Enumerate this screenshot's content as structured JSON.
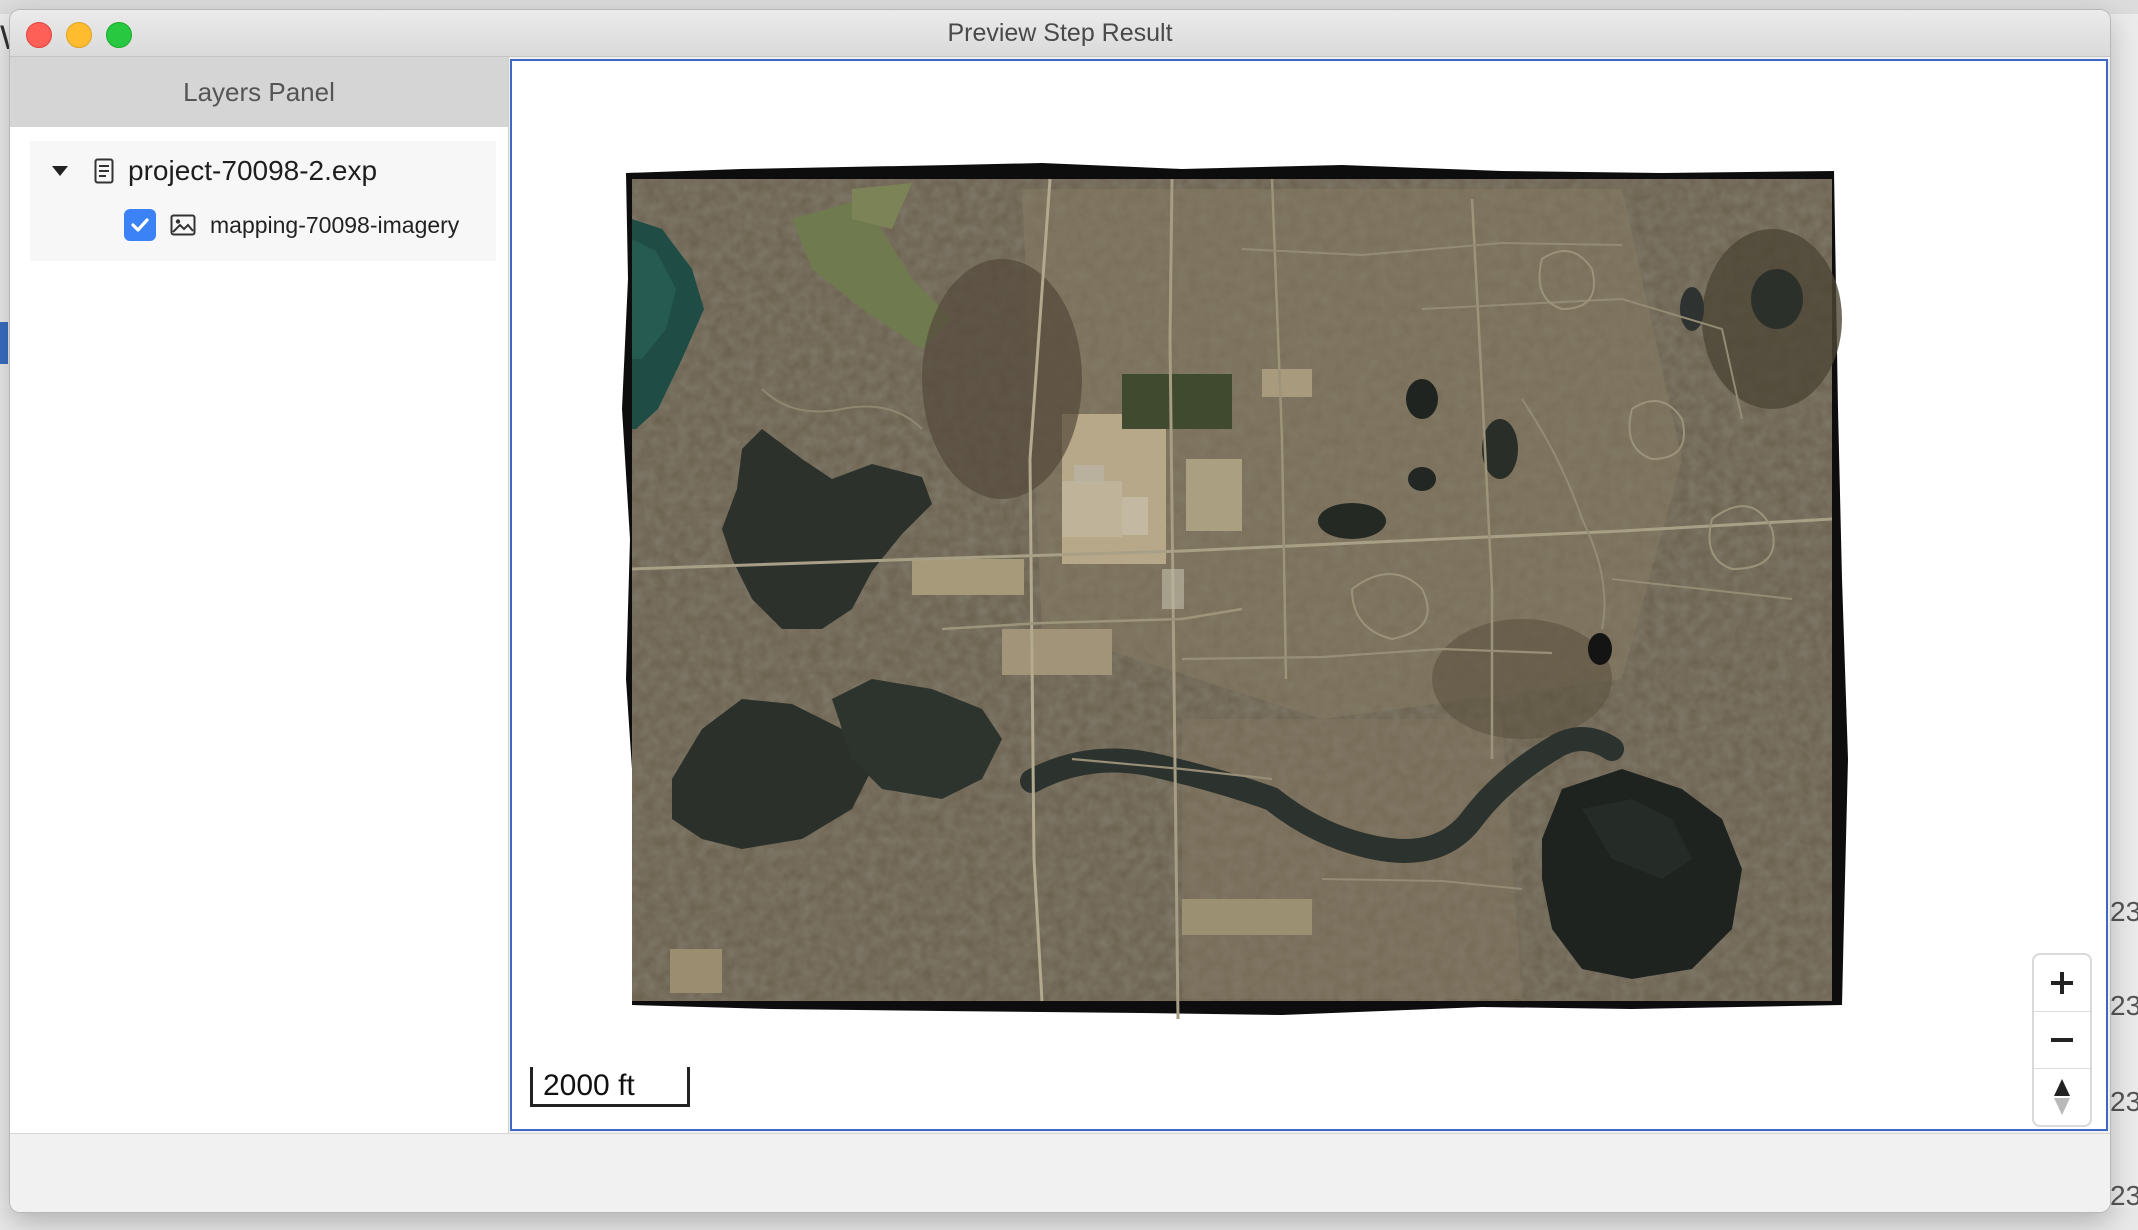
{
  "window": {
    "title": "Preview Step Result"
  },
  "layers_panel": {
    "header": "Layers Panel",
    "project": {
      "name": "project-70098-2.exp",
      "expanded": true,
      "layers": [
        {
          "name": "mapping-70098-imagery",
          "checked": true
        }
      ]
    }
  },
  "map": {
    "scale_label": "2000 ft",
    "controls": [
      {
        "icon": "plus-icon",
        "action": "zoom-in"
      },
      {
        "icon": "minus-icon",
        "action": "zoom-out"
      },
      {
        "icon": "compass-icon",
        "action": "reset-north"
      }
    ]
  },
  "background": {
    "right_numbers": [
      "23",
      "23",
      "23",
      "23"
    ]
  },
  "colors": {
    "selection_border": "#3d68c4",
    "checkbox": "#3a82f6",
    "close": "#fe5f57",
    "minimize": "#febc2e",
    "maximize": "#28c840"
  }
}
